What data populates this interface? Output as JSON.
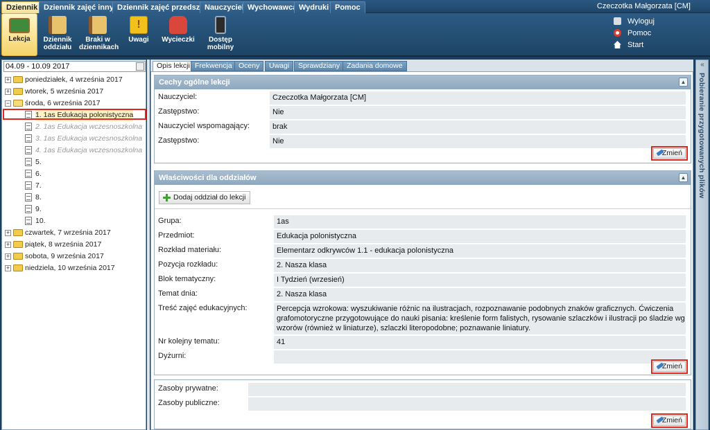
{
  "menu": {
    "tabs": [
      "Dziennik",
      "Dziennik zajęć innych",
      "Dziennik zajęć przedszkola",
      "Nauczyciel",
      "Wychowawca",
      "Wydruki",
      "Pomoc"
    ],
    "active": "Dziennik",
    "user": "Czeczotka Małgorzata [CM]"
  },
  "toolbar": {
    "items": [
      {
        "label": "Lekcja",
        "icon": "lesson-board-icon"
      },
      {
        "label": "Dziennik oddziału",
        "icon": "class-register-icon"
      },
      {
        "label": "Braki w dziennikach",
        "icon": "missing-entries-icon"
      },
      {
        "label": "Uwagi",
        "icon": "notes-icon"
      },
      {
        "label": "Wycieczki",
        "icon": "backpack-icon"
      },
      {
        "label": "Dostęp mobilny",
        "icon": "mobile-icon"
      }
    ],
    "links": [
      {
        "label": "Wyloguj",
        "icon": "lock-icon"
      },
      {
        "label": "Pomoc",
        "icon": "lifebuoy-icon"
      },
      {
        "label": "Start",
        "icon": "home-icon"
      }
    ]
  },
  "sidebar": {
    "date_range": "04.09 - 10.09 2017",
    "days": {
      "mon": "poniedziałek, 4 września 2017",
      "tue": "wtorek, 5 września 2017",
      "wed": "środa, 6 września 2017",
      "thu": "czwartek, 7 września 2017",
      "fri": "piątek, 8 września 2017",
      "sat": "sobota, 9 września 2017",
      "sun": "niedziela, 10 września 2017"
    },
    "lessons": [
      "1. 1as Edukacja polonistyczna",
      "2. 1as Edukacja wczesnoszkolna",
      "3. 1as Edukacja wczesnoszkolna",
      "4. 1as Edukacja wczesnoszkolna",
      "5.",
      "6.",
      "7.",
      "8.",
      "9.",
      "10."
    ]
  },
  "tabs": [
    "Opis lekcji",
    "Frekwencja",
    "Oceny",
    "Uwagi",
    "Sprawdziany",
    "Zadania domowe"
  ],
  "general": {
    "title": "Cechy ogólne lekcji",
    "fields": [
      {
        "label": "Nauczyciel:",
        "value": "Czeczotka Małgorzata [CM]"
      },
      {
        "label": "Zastępstwo:",
        "value": "Nie"
      },
      {
        "label": "Nauczyciel wspomagający:",
        "value": "brak"
      },
      {
        "label": "Zastępstwo:",
        "value": "Nie"
      }
    ],
    "change_label": "Zmień"
  },
  "classes": {
    "title": "Właściwości dla oddziałów",
    "add_label": "Dodaj oddział do lekcji",
    "fields": [
      {
        "label": "Grupa:",
        "value": "1as"
      },
      {
        "label": "Przedmiot:",
        "value": "Edukacja polonistyczna"
      },
      {
        "label": "Rozkład materiału:",
        "value": "Elementarz odkrywców 1.1 - edukacja polonistyczna"
      },
      {
        "label": "Pozycja rozkładu:",
        "value": "2. Nasza klasa"
      },
      {
        "label": "Blok tematyczny:",
        "value": "I Tydzień (wrzesień)"
      },
      {
        "label": "Temat dnia:",
        "value": "2. Nasza klasa"
      }
    ],
    "content_label": "Treść zajęć edukacyjnych:",
    "content_lines": [
      "Percepcja wzrokowa: wyszukiwanie różnic na ilustracjach, rozpoznawanie podobnych znaków graficznych. Ćwiczenia",
      "grafomotoryczne przygotowujące do nauki pisania: kreślenie form falistych, rysowanie szlaczków i ilustracji po śladzie wg",
      "wzorów (również w liniaturze), szlaczki literopodobne; poznawanie liniatury."
    ],
    "topic_no_label": "Nr kolejny tematu:",
    "topic_no": "41",
    "duty_label": "Dyżurni:",
    "duty": "",
    "change_label": "Zmień"
  },
  "resources": {
    "private_label": "Zasoby prywatne:",
    "private": "",
    "public_label": "Zasoby publiczne:",
    "public": "",
    "change_label": "Zmień"
  },
  "right_panel": {
    "label": "Pobieranie przygotowanych plików"
  },
  "colors": {
    "accent": "#e1261c",
    "header": "#1e4568"
  }
}
